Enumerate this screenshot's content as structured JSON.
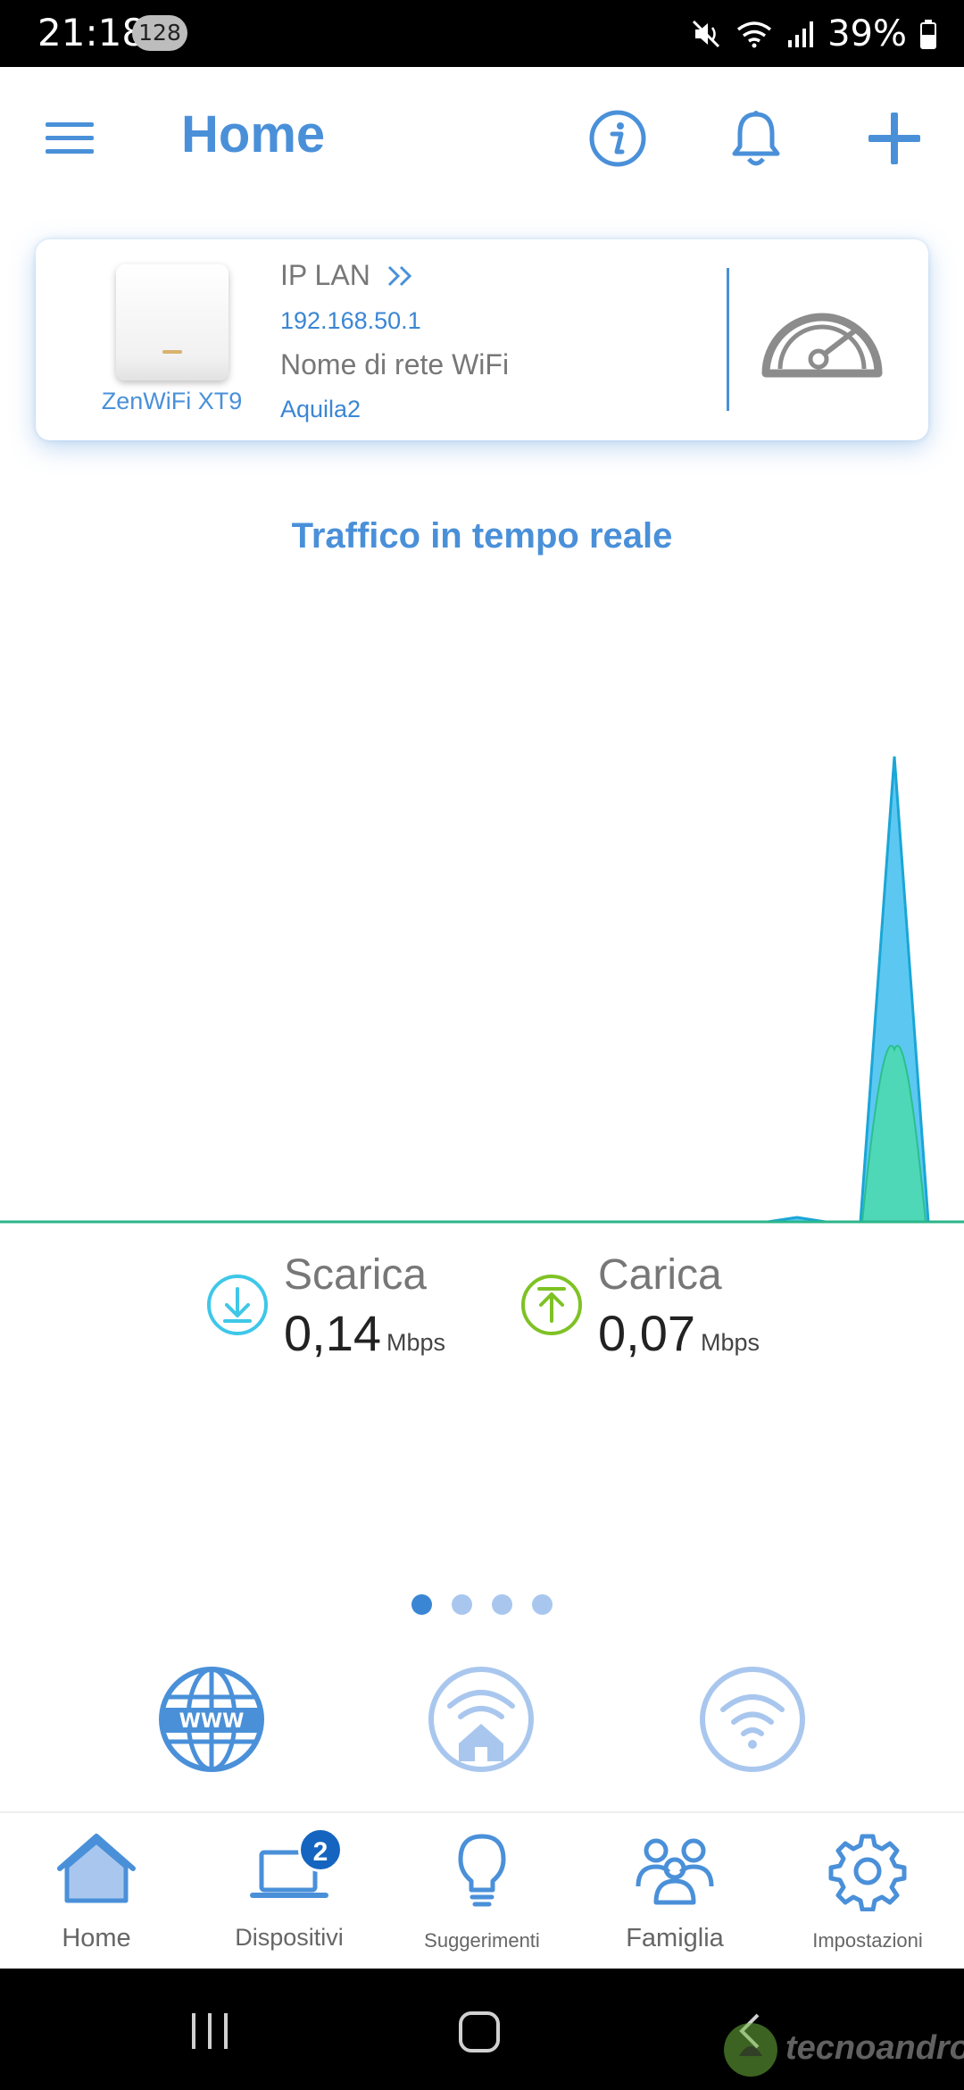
{
  "status_bar": {
    "time": "21:18",
    "badge": "128",
    "battery": "39%"
  },
  "header": {
    "title": "Home"
  },
  "router": {
    "device_name": "ZenWiFi XT9",
    "ip_label": "IP LAN",
    "ip_value": "192.168.50.1",
    "network_label": "Nome di rete WiFi",
    "network_value": "Aquila2"
  },
  "traffic": {
    "title": "Traffico in tempo reale",
    "download_label": "Scarica",
    "download_value": "0,14",
    "upload_label": "Carica",
    "upload_value": "0,07",
    "unit": "Mbps"
  },
  "pager": {
    "count": 4,
    "active": 0
  },
  "bottom_nav": {
    "home": "Home",
    "devices": "Dispositivi",
    "devices_badge": "2",
    "tips": "Suggerimenti",
    "family": "Famiglia",
    "settings": "Impostazioni"
  },
  "watermark": "tecnoandroid",
  "colors": {
    "accent": "#4a90d9",
    "download": "#3ec7e8",
    "upload": "#7ec224"
  }
}
